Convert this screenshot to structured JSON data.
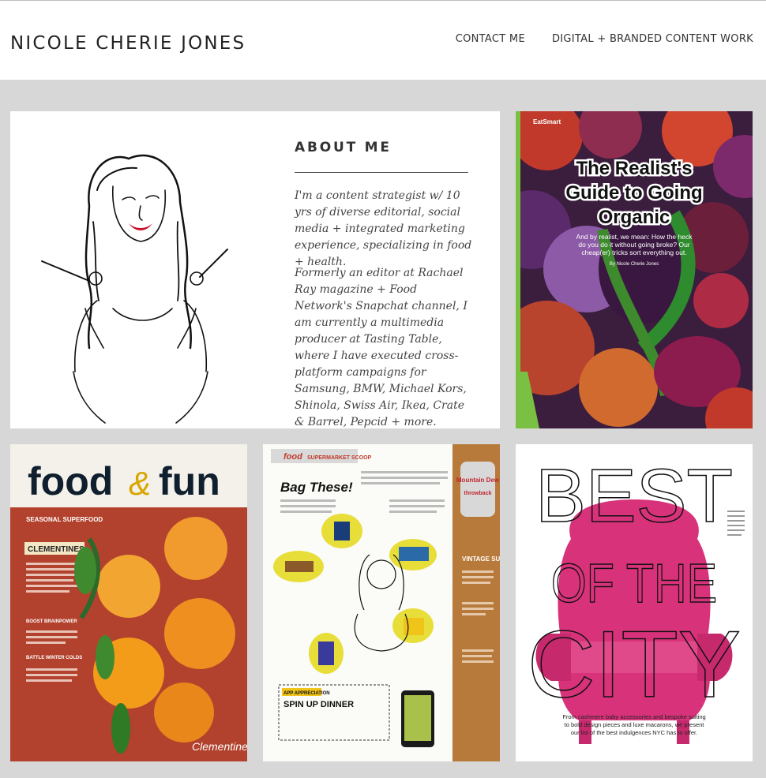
{
  "site": {
    "title": "NICOLE CHERIE JONES"
  },
  "nav": {
    "items": [
      {
        "label": "CONTACT ME"
      },
      {
        "label": "DIGITAL + BRANDED CONTENT WORK"
      }
    ]
  },
  "about": {
    "heading": "ABOUT ME",
    "paragraphs": [
      "I'm a content strategist w/ 10 yrs of diverse editorial, social media + integrated marketing experience, specializing in food + health.",
      "Formerly an editor at Rachael Ray magazine + Food Network's Snapchat channel, I am currently a multimedia producer at Tasting Table, where I have executed cross-platform campaigns for Samsung, BMW, Michael Kors, Shinola, Swiss Air, Ikea, Crate & Barrel, Pepcid + more."
    ]
  },
  "tiles": {
    "organic": {
      "kicker": "EatSmart",
      "headline_1": "The Realist's",
      "headline_2": "Guide to Going",
      "headline_3": "Organic",
      "dek_1": "And by realist, we mean: How the heck",
      "dek_2": "do you do it without going broke? Our",
      "dek_3": "cheap(er) tricks sort everything out.",
      "byline": "By Nicole Cherie Jones"
    },
    "foodfun": {
      "masthead_1": "food",
      "masthead_amp": "&",
      "masthead_2": "fun",
      "section": "SEASONAL SUPERFOOD",
      "label": "CLEMENTINES",
      "bullet_1": "BOOST BRAINPOWER",
      "bullet_2": "BATTLE WINTER COLDS",
      "footer_sign": "Clementine"
    },
    "bag": {
      "kicker": "food",
      "kicker_2": "SUPERMARKET SCOOP",
      "headline": "Bag These!",
      "section": "APP APPRECIATION",
      "app_headline": "SPIN UP DINNER",
      "can_brand": "Mountain Dew",
      "can_sub": "throwback",
      "sidebar": "VINTAGE SUMMER"
    },
    "city": {
      "word_1": "BEST",
      "word_2": "OF THE",
      "word_3": "CITY",
      "dek_1": "From cashmere baby accessories and bespoke suiting",
      "dek_2": "to bold design pieces and luxe macarons, we present",
      "dek_3": "our list of the best indulgences NYC has to offer."
    }
  },
  "colors": {
    "page_bg": "#d7d7d7",
    "header_bg": "#ffffff",
    "title_text": "#222222",
    "about_text": "#444444",
    "chair_pink": "#d8337a",
    "organic_green": "#7ac143",
    "foodfun_red": "#b2412d"
  }
}
